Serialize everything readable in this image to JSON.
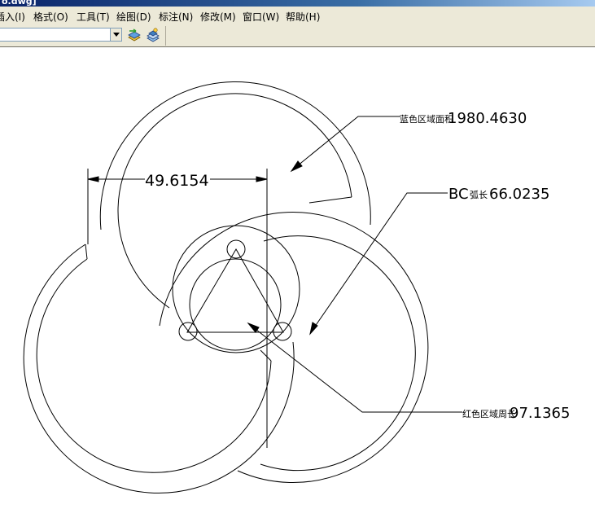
{
  "window": {
    "title": "o.dwg]"
  },
  "menu": [
    {
      "id": "insert",
      "label": "插入(I)"
    },
    {
      "id": "format",
      "label": "格式(O)"
    },
    {
      "id": "tools",
      "label": "工具(T)"
    },
    {
      "id": "draw",
      "label": "绘图(D)"
    },
    {
      "id": "dimension",
      "label": "标注(N)"
    },
    {
      "id": "modify",
      "label": "修改(M)"
    },
    {
      "id": "window",
      "label": "窗口(W)"
    },
    {
      "id": "help",
      "label": "帮助(H)"
    }
  ],
  "toolbar": {
    "layer_combo_value": "",
    "icons": [
      "layer-previous-icon",
      "layer-states-icon"
    ]
  },
  "drawing": {
    "dim_width": "49.6154",
    "blue_area_label": "蓝色区域面积",
    "blue_area_value": "1980.4630",
    "arc_label_prefix": "BC",
    "arc_label_cn": "弧长",
    "arc_value": "66.0235",
    "red_perimeter_label": "红色区域周长",
    "red_perimeter_value": "97.1365"
  }
}
